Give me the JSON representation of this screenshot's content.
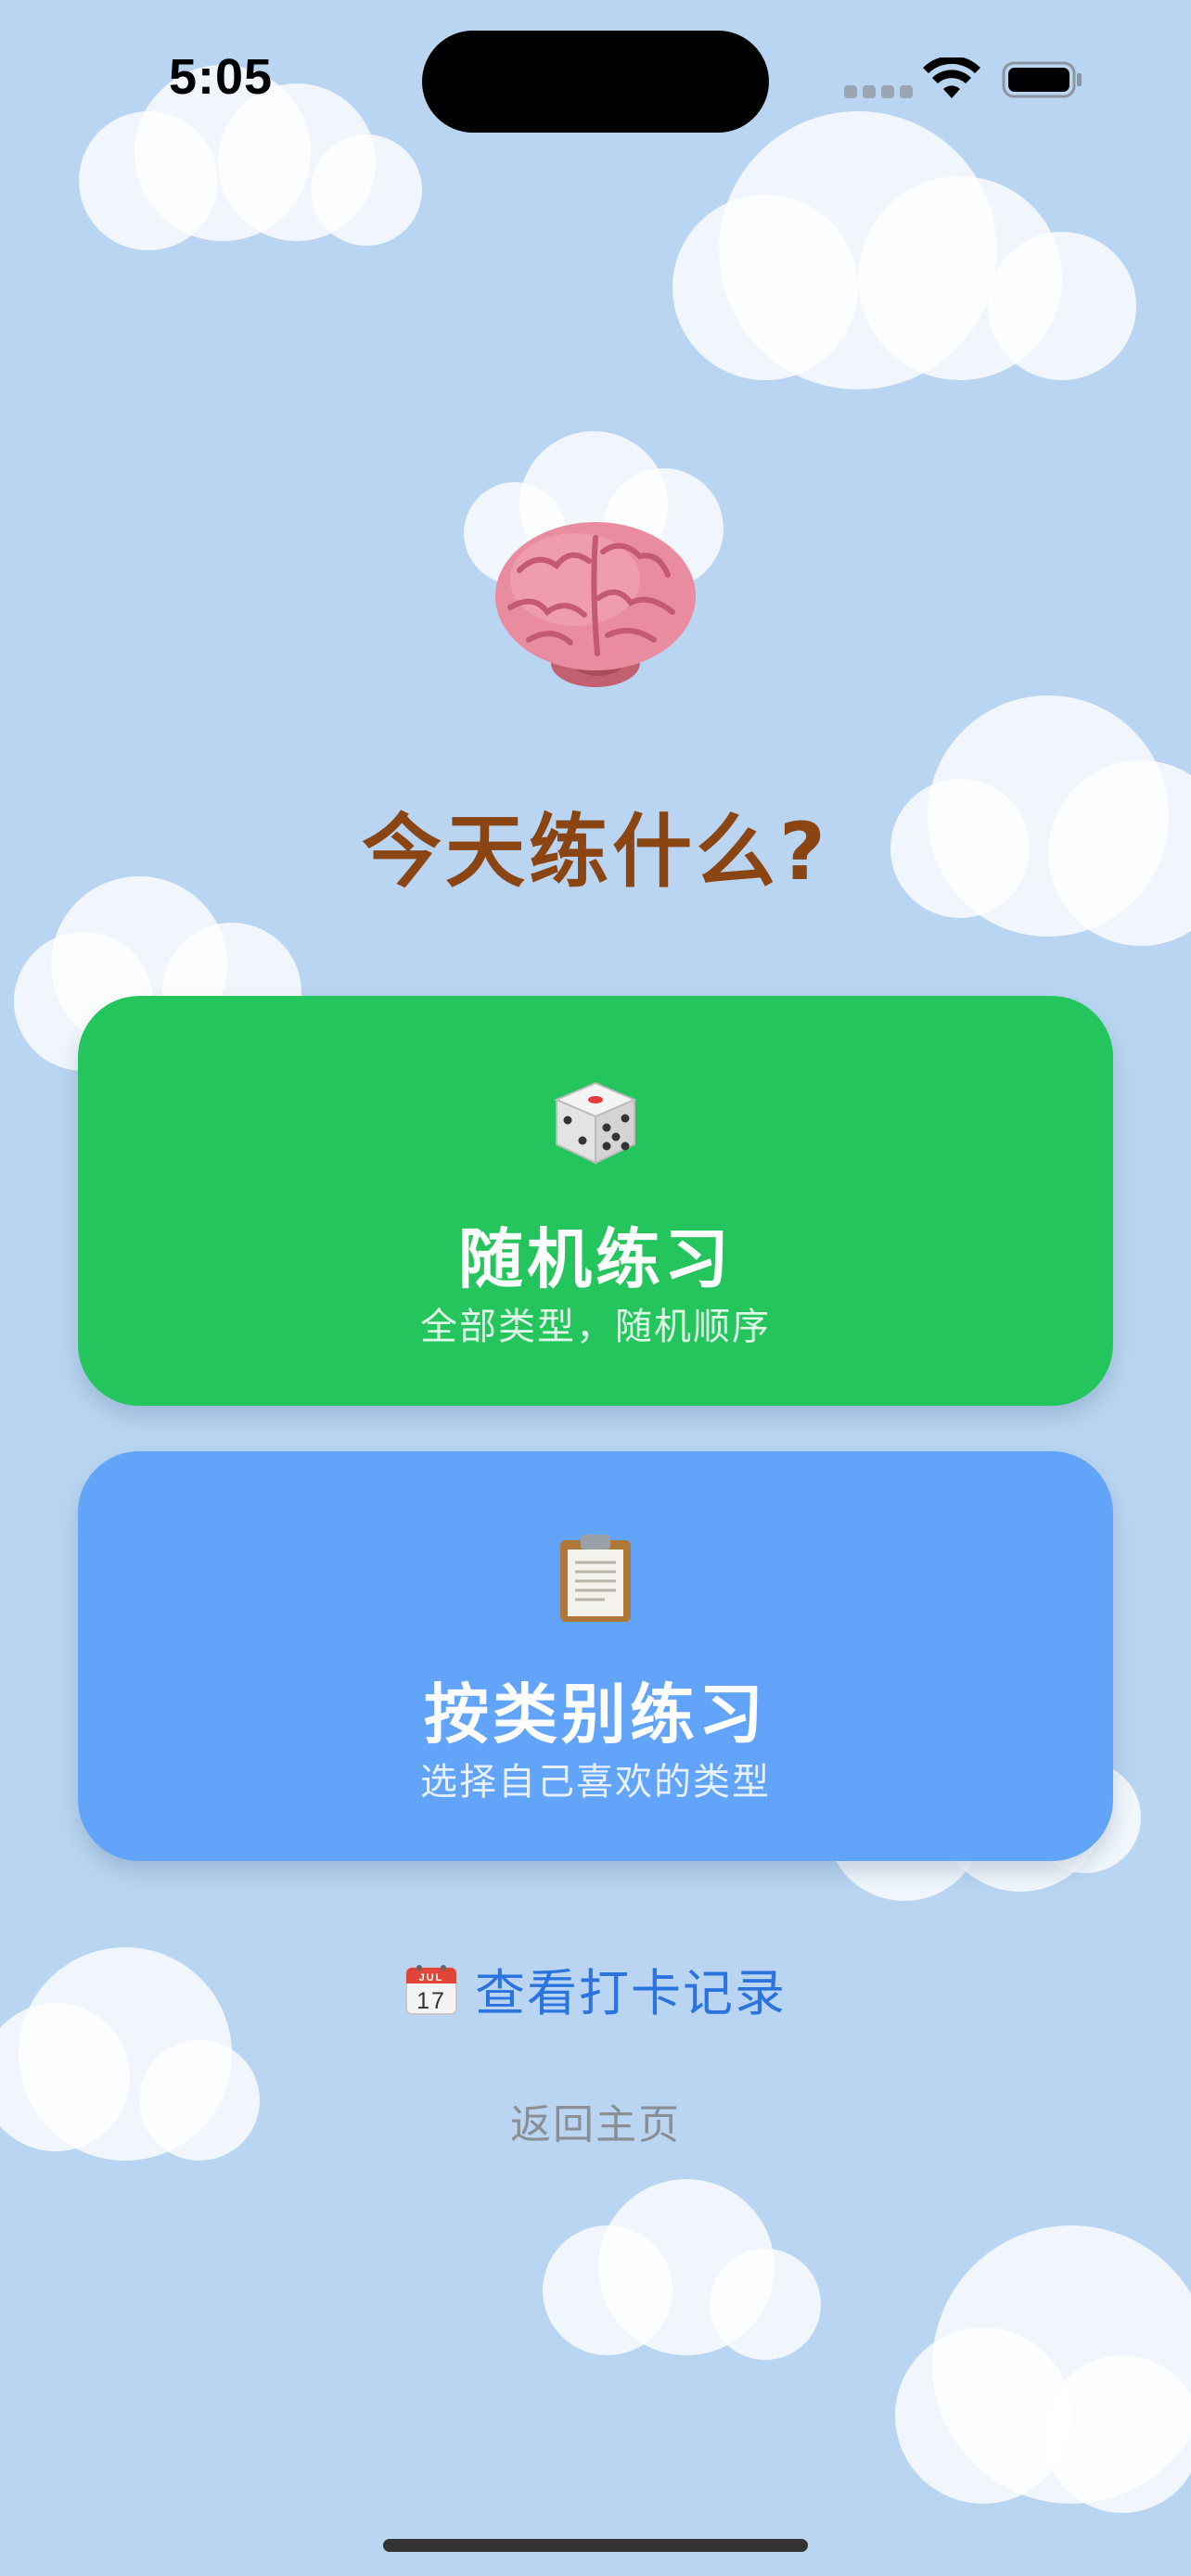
{
  "status_bar": {
    "time": "5:05"
  },
  "main": {
    "hero_icon": "brain-emoji",
    "title": "今天练什么?",
    "cards": [
      {
        "icon": "dice-icon",
        "title": "随机练习",
        "subtitle": "全部类型，随机顺序",
        "color": "#25c55d"
      },
      {
        "icon": "clipboard-icon",
        "title": "按类别练习",
        "subtitle": "选择自己喜欢的类型",
        "color": "#61a4f9"
      }
    ],
    "checkin": {
      "icon": "calendar-icon",
      "calendar_month": "JUL",
      "calendar_day": "17",
      "label": "查看打卡记录"
    },
    "home_link": "返回主页"
  },
  "colors": {
    "background": "#b9d5f1",
    "title": "#8b4513",
    "link": "#2b74e0",
    "muted": "#8a8f96"
  }
}
